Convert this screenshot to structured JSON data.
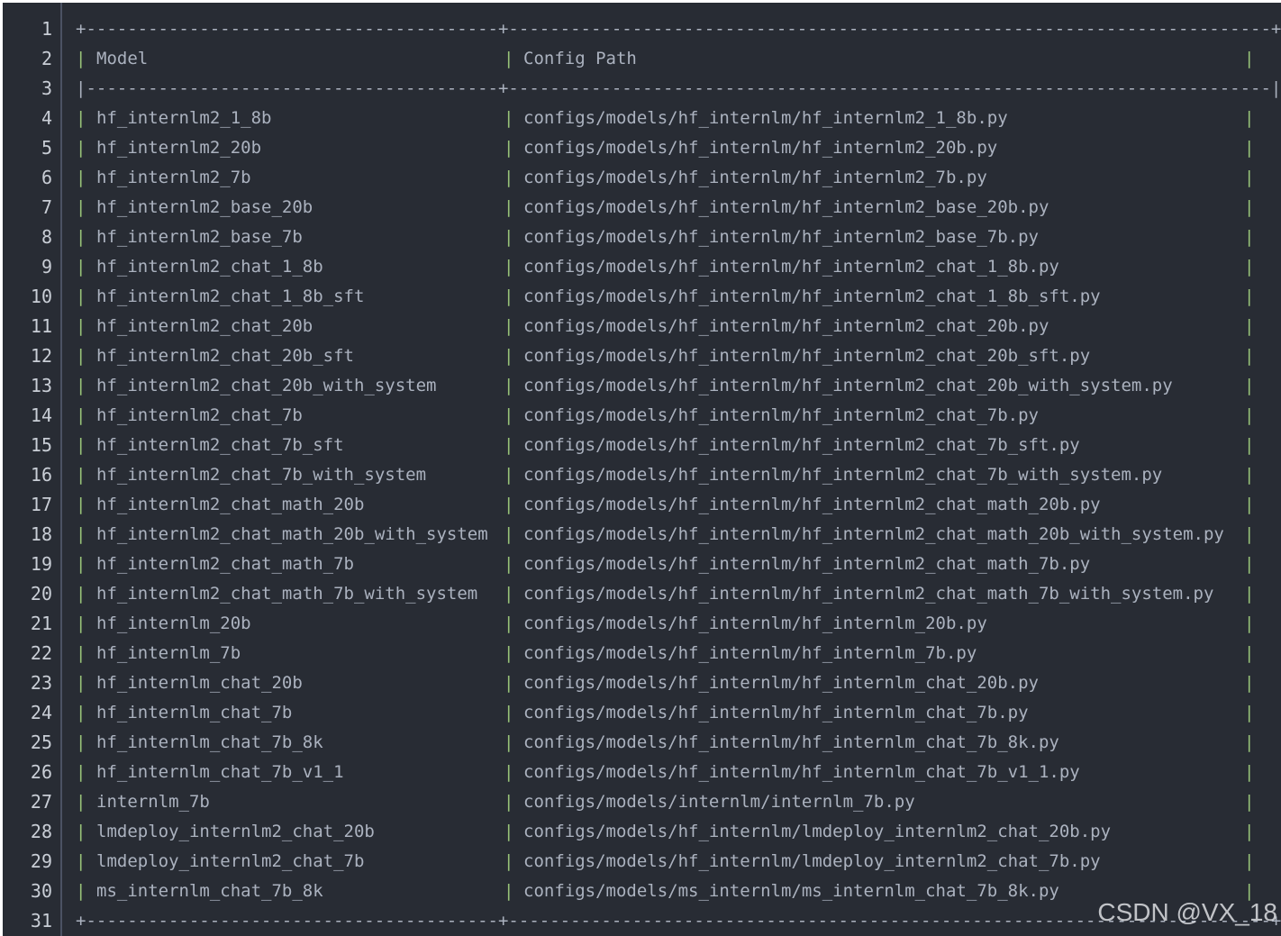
{
  "code": {
    "border_line": "+----------------------------------------+--------------------------------------------------------------------------+",
    "header_separator": "|----------------------------------------+--------------------------------------------------------------------------|",
    "pipe": "|",
    "header": {
      "model": "Model",
      "config_path": "Config Path"
    },
    "rows": [
      {
        "model": "hf_internlm2_1_8b",
        "path": "configs/models/hf_internlm/hf_internlm2_1_8b.py"
      },
      {
        "model": "hf_internlm2_20b",
        "path": "configs/models/hf_internlm/hf_internlm2_20b.py"
      },
      {
        "model": "hf_internlm2_7b",
        "path": "configs/models/hf_internlm/hf_internlm2_7b.py"
      },
      {
        "model": "hf_internlm2_base_20b",
        "path": "configs/models/hf_internlm/hf_internlm2_base_20b.py"
      },
      {
        "model": "hf_internlm2_base_7b",
        "path": "configs/models/hf_internlm/hf_internlm2_base_7b.py"
      },
      {
        "model": "hf_internlm2_chat_1_8b",
        "path": "configs/models/hf_internlm/hf_internlm2_chat_1_8b.py"
      },
      {
        "model": "hf_internlm2_chat_1_8b_sft",
        "path": "configs/models/hf_internlm/hf_internlm2_chat_1_8b_sft.py"
      },
      {
        "model": "hf_internlm2_chat_20b",
        "path": "configs/models/hf_internlm/hf_internlm2_chat_20b.py"
      },
      {
        "model": "hf_internlm2_chat_20b_sft",
        "path": "configs/models/hf_internlm/hf_internlm2_chat_20b_sft.py"
      },
      {
        "model": "hf_internlm2_chat_20b_with_system",
        "path": "configs/models/hf_internlm/hf_internlm2_chat_20b_with_system.py"
      },
      {
        "model": "hf_internlm2_chat_7b",
        "path": "configs/models/hf_internlm/hf_internlm2_chat_7b.py"
      },
      {
        "model": "hf_internlm2_chat_7b_sft",
        "path": "configs/models/hf_internlm/hf_internlm2_chat_7b_sft.py"
      },
      {
        "model": "hf_internlm2_chat_7b_with_system",
        "path": "configs/models/hf_internlm/hf_internlm2_chat_7b_with_system.py"
      },
      {
        "model": "hf_internlm2_chat_math_20b",
        "path": "configs/models/hf_internlm/hf_internlm2_chat_math_20b.py"
      },
      {
        "model": "hf_internlm2_chat_math_20b_with_system",
        "path": "configs/models/hf_internlm/hf_internlm2_chat_math_20b_with_system.py"
      },
      {
        "model": "hf_internlm2_chat_math_7b",
        "path": "configs/models/hf_internlm/hf_internlm2_chat_math_7b.py"
      },
      {
        "model": "hf_internlm2_chat_math_7b_with_system",
        "path": "configs/models/hf_internlm/hf_internlm2_chat_math_7b_with_system.py"
      },
      {
        "model": "hf_internlm_20b",
        "path": "configs/models/hf_internlm/hf_internlm_20b.py"
      },
      {
        "model": "hf_internlm_7b",
        "path": "configs/models/hf_internlm/hf_internlm_7b.py"
      },
      {
        "model": "hf_internlm_chat_20b",
        "path": "configs/models/hf_internlm/hf_internlm_chat_20b.py"
      },
      {
        "model": "hf_internlm_chat_7b",
        "path": "configs/models/hf_internlm/hf_internlm_chat_7b.py"
      },
      {
        "model": "hf_internlm_chat_7b_8k",
        "path": "configs/models/hf_internlm/hf_internlm_chat_7b_8k.py"
      },
      {
        "model": "hf_internlm_chat_7b_v1_1",
        "path": "configs/models/hf_internlm/hf_internlm_chat_7b_v1_1.py"
      },
      {
        "model": "internlm_7b",
        "path": "configs/models/internlm/internlm_7b.py"
      },
      {
        "model": "lmdeploy_internlm2_chat_20b",
        "path": "configs/models/hf_internlm/lmdeploy_internlm2_chat_20b.py"
      },
      {
        "model": "lmdeploy_internlm2_chat_7b",
        "path": "configs/models/hf_internlm/lmdeploy_internlm2_chat_7b.py"
      },
      {
        "model": "ms_internlm_chat_7b_8k",
        "path": "configs/models/ms_internlm/ms_internlm_chat_7b_8k.py"
      }
    ]
  },
  "watermark": "CSDN @VX_18",
  "colors": {
    "background": "#282c34",
    "text": "#abb2bf",
    "pipe": "#98c379",
    "line_number": "#c9ced6"
  }
}
